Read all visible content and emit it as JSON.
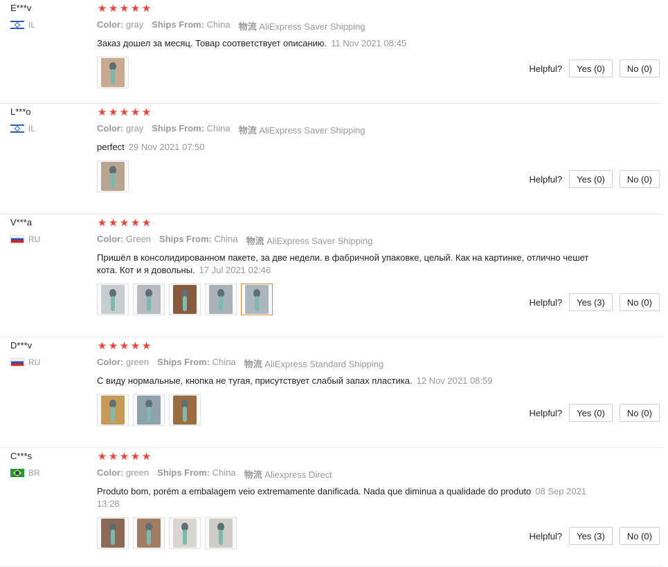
{
  "labels": {
    "color": "Color:",
    "ships_from": "Ships From:",
    "shipping": "物流",
    "helpful": "Helpful?"
  },
  "reviews": [
    {
      "user": "E***v",
      "country": "IL",
      "flag": "il",
      "stars": 5,
      "color": "gray",
      "ships_from": "China",
      "shipping": "AliExpress Saver Shipping",
      "text": "Заказ дошел за месяц. Товар соответствует описанию.",
      "date": "11 Nov 2021 08:45",
      "yes": "Yes (0)",
      "no": "No (0)",
      "images": [
        {
          "bg": "#c9a98f"
        }
      ]
    },
    {
      "user": "L***o",
      "country": "IL",
      "flag": "il",
      "stars": 5,
      "color": "gray",
      "ships_from": "China",
      "shipping": "AliExpress Saver Shipping",
      "text": "perfect",
      "date": "29 Nov 2021 07:50",
      "yes": "Yes (0)",
      "no": "No (0)",
      "images": [
        {
          "bg": "#b7a58f"
        }
      ]
    },
    {
      "user": "V***a",
      "country": "RU",
      "flag": "ru",
      "stars": 5,
      "color": "Green",
      "ships_from": "China",
      "shipping": "AliExpress Saver Shipping",
      "text": "Пришёл в консолидированном пакете, за две недели. в фабричной упаковке, целый. Как на картинке, отлично чешет кота. Кот и я довольны.",
      "date": "17 Jul 2021 02:46",
      "yes": "Yes (3)",
      "no": "No (0)",
      "images": [
        {
          "bg": "#c8cdd0"
        },
        {
          "bg": "#b8bcc0"
        },
        {
          "bg": "#8a5a3c"
        },
        {
          "bg": "#a9b2b6"
        },
        {
          "bg": "#aeb6bd"
        }
      ]
    },
    {
      "user": "D***v",
      "country": "RU",
      "flag": "ru",
      "stars": 5,
      "color": "green",
      "ships_from": "China",
      "shipping": "AliExpress Standard Shipping",
      "text": "С виду нормальные, кнопка не тугая, присутствует слабый запах пластика.",
      "date": "12 Nov 2021 08:59",
      "yes": "Yes (0)",
      "no": "No (0)",
      "images": [
        {
          "bg": "#c69a57"
        },
        {
          "bg": "#8fa3ad"
        },
        {
          "bg": "#9c6b3e"
        }
      ]
    },
    {
      "user": "C***s",
      "country": "BR",
      "flag": "br",
      "stars": 5,
      "color": "green",
      "ships_from": "China",
      "shipping": "Aliexpress Direct",
      "text": "Produto bom, porém a embalagem veio extremamente danificada. Nada que diminua a qualidade do produto",
      "date": "08 Sep 2021 13:28",
      "yes": "Yes (3)",
      "no": "No (0)",
      "images": [
        {
          "bg": "#8d6a55"
        },
        {
          "bg": "#a27c62"
        },
        {
          "bg": "#d9d6d2"
        },
        {
          "bg": "#cfcbc6"
        }
      ]
    }
  ]
}
